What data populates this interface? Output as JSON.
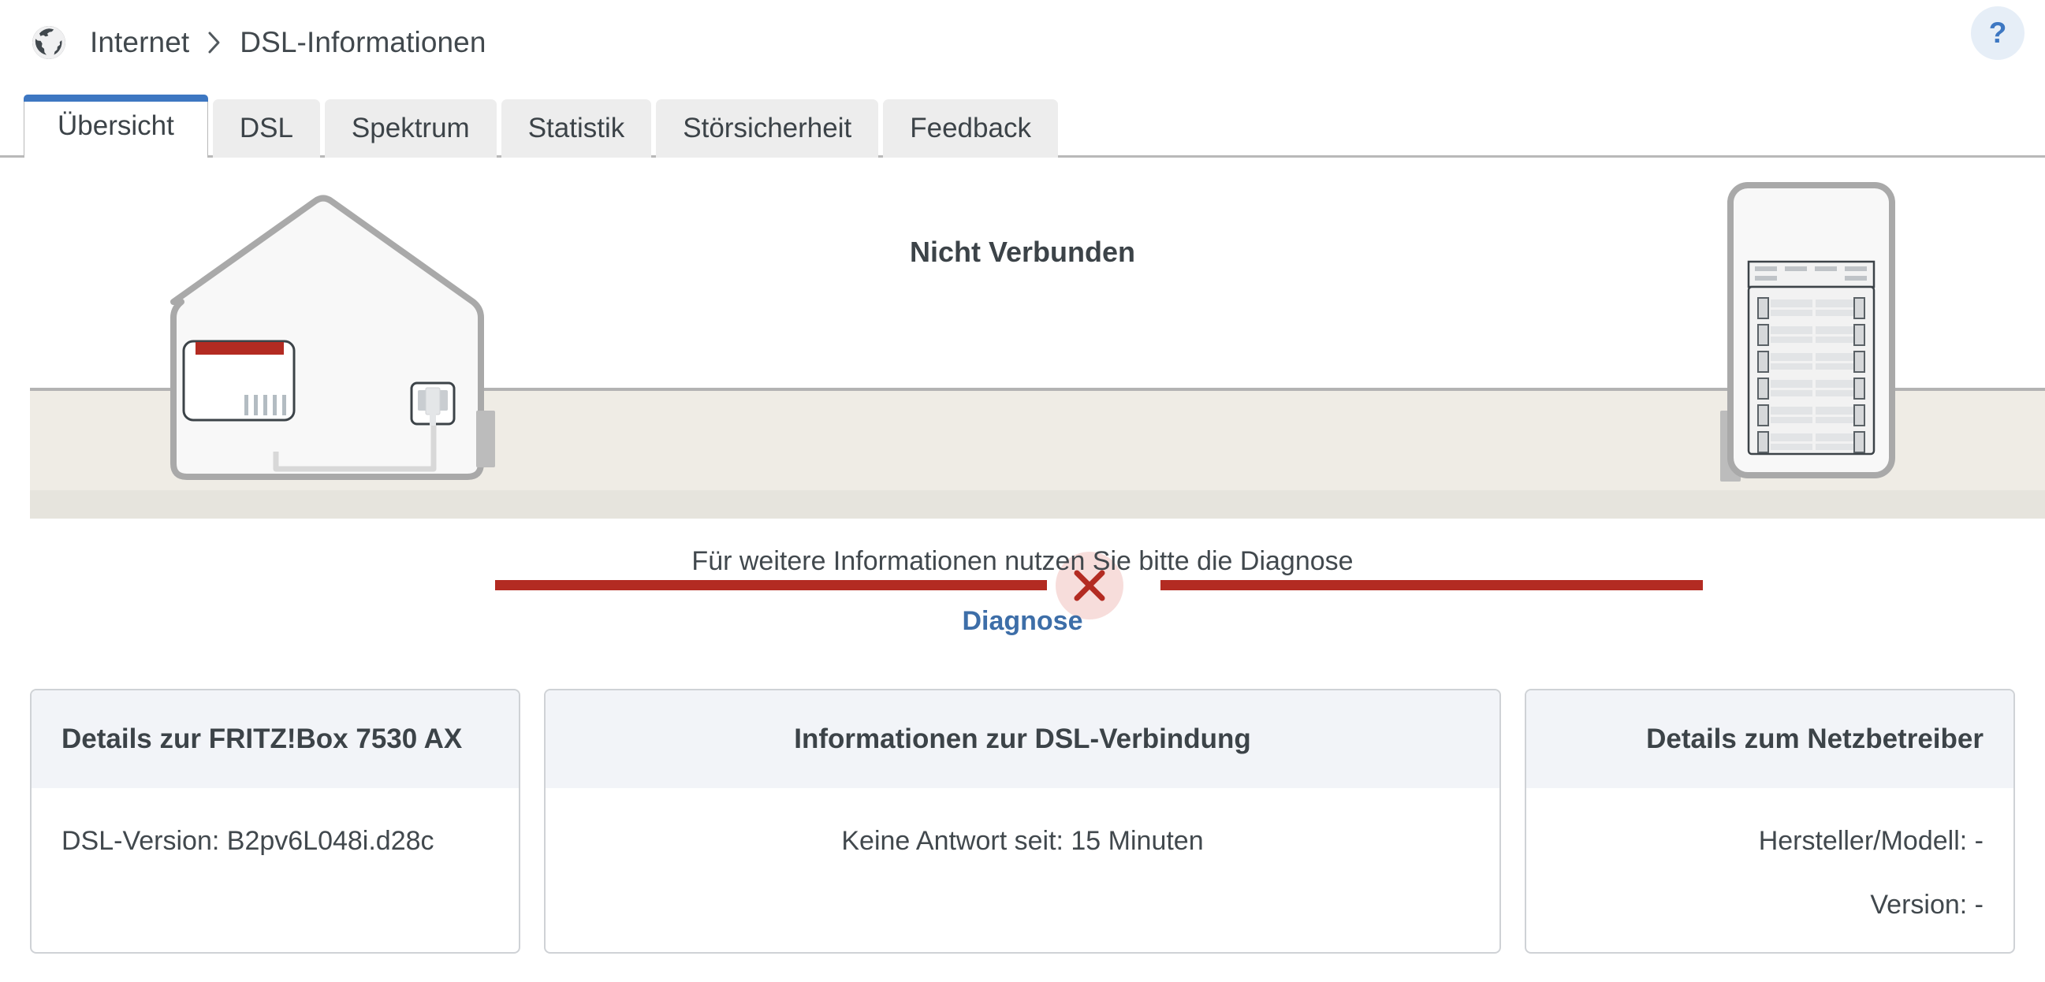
{
  "header": {
    "globe_icon": "globe-icon",
    "breadcrumb": [
      "Internet",
      "DSL-Informationen"
    ],
    "help_label": "?"
  },
  "tabs": [
    {
      "label": "Übersicht",
      "active": true
    },
    {
      "label": "DSL",
      "active": false
    },
    {
      "label": "Spektrum",
      "active": false
    },
    {
      "label": "Statistik",
      "active": false
    },
    {
      "label": "Störsicherheit",
      "active": false
    },
    {
      "label": "Feedback",
      "active": false
    }
  ],
  "scene": {
    "status": "Nicht Verbunden",
    "status_icon": "error-x-icon",
    "house_icon": "house-with-router-icon",
    "dslam_icon": "network-cabinet-icon",
    "line_color": "#b32b22",
    "ground_color": "#efece5"
  },
  "hint": {
    "text": "Für weitere Informationen nutzen Sie bitte die Diagnose",
    "link": "Diagnose",
    "link_color": "#3d6ea8"
  },
  "cards": [
    {
      "title": "Details zur FRITZ!Box 7530 AX",
      "rows": [
        "DSL-Version: B2pv6L048i.d28c"
      ]
    },
    {
      "title": "Informationen zur DSL-Verbindung",
      "rows": [
        "Keine Antwort seit: 15 Minuten"
      ]
    },
    {
      "title": "Details zum Netzbetreiber",
      "rows": [
        "Hersteller/Modell: -",
        "Version: -"
      ]
    }
  ]
}
